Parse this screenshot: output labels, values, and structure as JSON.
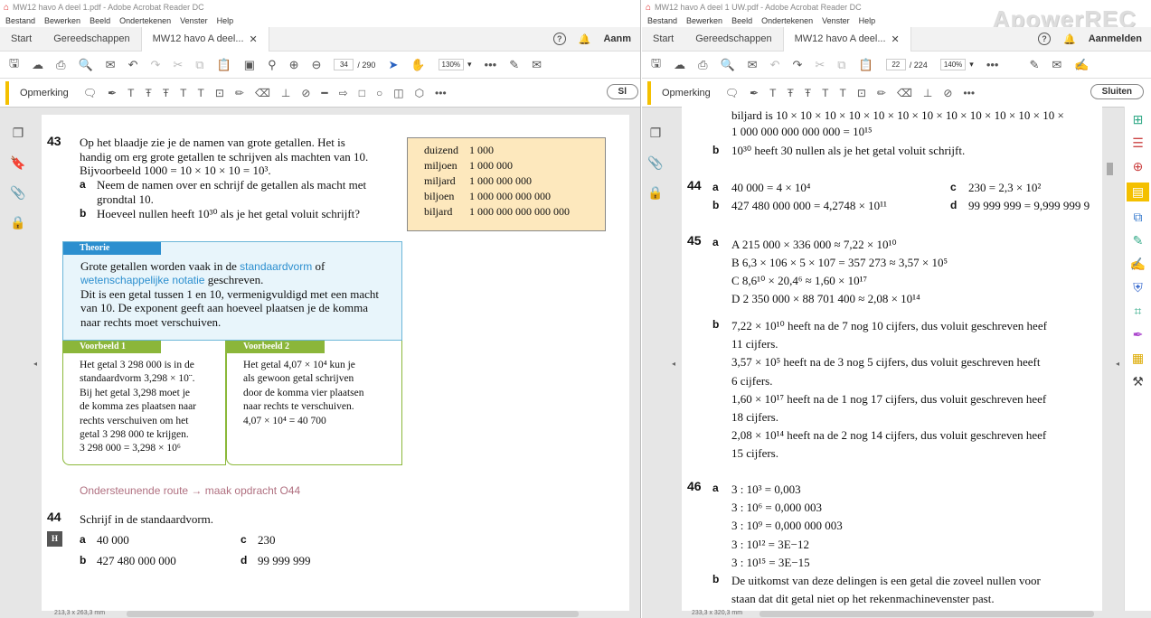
{
  "left": {
    "title": "MW12 havo A deel 1.pdf - Adobe Acrobat Reader DC",
    "menu": [
      "Bestand",
      "Bewerken",
      "Beeld",
      "Ondertekenen",
      "Venster",
      "Help"
    ],
    "tabs": {
      "start": "Start",
      "tools": "Gereedschappen",
      "doc": "MW12 havo A deel...",
      "signin": "Aanm"
    },
    "page_current": "34",
    "page_total": "/ 290",
    "zoom": "130%",
    "comment_label": "Opmerking",
    "close_label": "Sl",
    "status": "213,3 x 263,3 mm",
    "content": {
      "q43_num": "43",
      "q43_l1": "Op het blaadje zie je de namen van grote getallen. Het is",
      "q43_l2": "handig om erg grote getallen te schrijven als machten van 10.",
      "q43_l3": "Bijvoorbeeld 1000 = 10 × 10 × 10 = 10³.",
      "q43a_l": "a",
      "q43a_1": "Neem de namen over en schrijf de getallen als macht met",
      "q43a_2": "grondtal 10.",
      "q43b_l": "b",
      "q43b": "Hoeveel nullen heeft 10³⁰ als je het getal voluit schrijft?",
      "table": [
        {
          "name": "duizend",
          "value": "1 000"
        },
        {
          "name": "miljoen",
          "value": "1 000 000"
        },
        {
          "name": "miljard",
          "value": "1 000 000 000"
        },
        {
          "name": "biljoen",
          "value": "1 000 000 000 000"
        },
        {
          "name": "biljard",
          "value": "1 000 000 000 000 000"
        }
      ],
      "theory_hd": "Theorie",
      "theory_1a": "Grote getallen worden vaak in de ",
      "theory_1b": "standaardvorm",
      "theory_1c": " of",
      "theory_2a": "wetenschappelijke notatie",
      "theory_2b": " geschreven.",
      "theory_3": "Dit is een getal tussen 1 en 10, vermenigvuldigd met een macht",
      "theory_4": "van 10. De exponent geeft aan hoeveel plaatsen je de komma",
      "theory_5": "naar rechts moet verschuiven.",
      "ex1_hd": "Voorbeeld 1",
      "ex1": [
        "Het getal  3 298 000 is in de",
        "standaardvorm 3,298 × 10¨.",
        "Bij het getal 3,298 moet je",
        "de komma zes plaatsen naar",
        "rechts verschuiven om het",
        "getal 3 298 000 te krijgen.",
        "3 298 000 = 3,298 × 10⁶"
      ],
      "ex2_hd": "Voorbeeld 2",
      "ex2": [
        "Het getal  4,07 × 10⁴ kun je",
        "als gewoon getal schrijven",
        "door de komma vier plaatsen",
        "naar rechts te verschuiven.",
        "4,07 × 10⁴ =  40 700"
      ],
      "route": "Ondersteunende route → maak opdracht O44",
      "q44_num": "44",
      "q44": "Schrijf in de standaardvorm.",
      "q44_badge": "H",
      "q44a_l": "a",
      "q44a": "40 000",
      "q44c_l": "c",
      "q44c": "230",
      "q44b_l": "b",
      "q44b": "427 480 000 000",
      "q44d_l": "d",
      "q44d": "99 999 999"
    }
  },
  "right": {
    "title": "MW12 havo A deel 1 UW.pdf - Adobe Acrobat Reader DC",
    "watermark": "ApowerREC",
    "menu": [
      "Bestand",
      "Bewerken",
      "Beeld",
      "Ondertekenen",
      "Venster",
      "Help"
    ],
    "tabs": {
      "start": "Start",
      "tools": "Gereedschappen",
      "doc": "MW12 havo A deel...",
      "signin": "Aanmelden"
    },
    "page_current": "22",
    "page_total": "/ 224",
    "zoom": "140%",
    "comment_label": "Opmerking",
    "close_label": "Sluiten",
    "status": "233,3 x 320,3 mm",
    "content": {
      "l_top1": "biljard is 10 × 10 × 10 × 10 × 10 × 10 × 10 × 10 × 10 × 10 × 10 × 10 ×",
      "l_top2": "1 000 000 000 000 000 = 10¹⁵",
      "b43_l": "b",
      "b43": "10³⁰ heeft 30 nullen als je het getal voluit schrijft.",
      "q44_num": "44",
      "q44a_l": "a",
      "q44a": "40 000 = 4 × 10⁴",
      "q44c_l": "c",
      "q44c": "230 = 2,3 × 10²",
      "q44b_l": "b",
      "q44b": "427 480 000 000 = 4,2748 × 10¹¹",
      "q44d_l": "d",
      "q44d": "99 999 999 = 9,999 999 9",
      "q45_num": "45",
      "q45a_l": "a",
      "q45": [
        "A  215 000 × 336 000 ≈ 7,22 × 10¹⁰",
        "B  6,3 × 106 × 5 × 107 = 357 273 ≈ 3,57 × 10⁵",
        "C  8,6¹⁰ × 20,4⁶ ≈ 1,60 × 10¹⁷",
        "D  2 350 000 × 88 701 400 ≈ 2,08 × 10¹⁴"
      ],
      "q45b_l": "b",
      "q45b": [
        "7,22 × 10¹⁰ heeft na de 7 nog 10 cijfers, dus voluit geschreven heef",
        "11 cijfers.",
        "3,57 × 10⁵ heeft na de 3 nog 5 cijfers, dus voluit geschreven heeft",
        "6 cijfers.",
        "1,60 × 10¹⁷ heeft na de 1 nog 17 cijfers, dus voluit geschreven heef",
        "18 cijfers.",
        "2,08 × 10¹⁴ heeft na de 2 nog 14 cijfers, dus voluit geschreven heef",
        "15 cijfers."
      ],
      "q46_num": "46",
      "q46a_l": "a",
      "q46": [
        "3 : 10³ = 0,003",
        "3 : 10⁶ = 0,000 003",
        "3 : 10⁹ = 0,000 000 003",
        "3 : 10¹² =  3E−12",
        "3 : 10¹⁵ =  3E−15"
      ],
      "q46b_l": "b",
      "q46b": [
        "De uitkomst van deze delingen is een getal die zoveel nullen voor",
        "staan dat dit getal niet op het rekenmachinevenster past."
      ]
    }
  }
}
